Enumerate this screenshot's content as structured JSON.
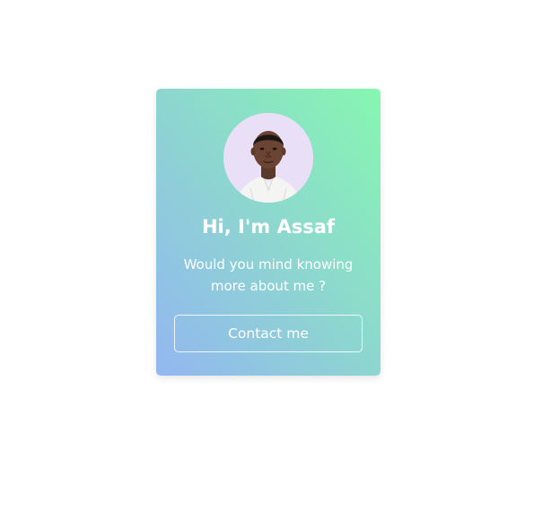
{
  "card": {
    "greeting": "Hi, I'm Assaf",
    "tagline": "Would you mind knowing more about me ?",
    "contact_label": "Contact me"
  },
  "colors": {
    "gradient_bottom_left": "#93b7f1",
    "gradient_top_right": "#86f7b0",
    "avatar_background": "#e9e0f7",
    "text": "#ffffff"
  }
}
